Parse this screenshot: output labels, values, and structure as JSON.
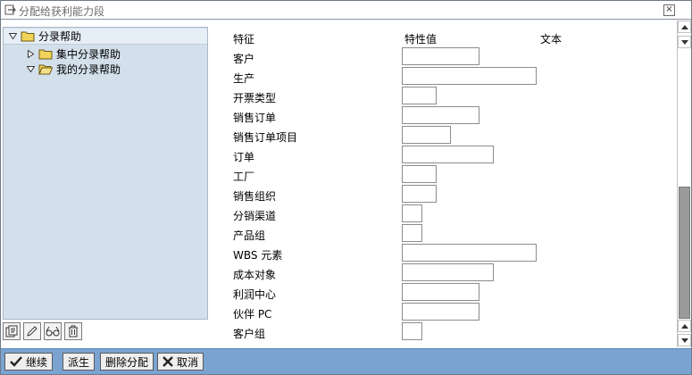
{
  "window": {
    "title": "分配给获利能力段",
    "close_symbol": "×"
  },
  "tree": {
    "items": [
      {
        "label": "分录帮助",
        "expanded": true
      },
      {
        "label": "集中分录帮助",
        "expanded": false
      },
      {
        "label": "我的分录帮助",
        "expanded": true
      }
    ]
  },
  "form": {
    "headers": {
      "feature": "特征",
      "value": "特性值",
      "text": "文本"
    },
    "rows": [
      {
        "label": "客户",
        "value": ""
      },
      {
        "label": "生产",
        "value": ""
      },
      {
        "label": "开票类型",
        "value": ""
      },
      {
        "label": "销售订单",
        "value": ""
      },
      {
        "label": "销售订单项目",
        "value": ""
      },
      {
        "label": "订单",
        "value": ""
      },
      {
        "label": "工厂",
        "value": ""
      },
      {
        "label": "销售组织",
        "value": ""
      },
      {
        "label": "分销渠道",
        "value": ""
      },
      {
        "label": "产品组",
        "value": ""
      },
      {
        "label": "WBS 元素",
        "value": ""
      },
      {
        "label": "成本对象",
        "value": ""
      },
      {
        "label": "利润中心",
        "value": ""
      },
      {
        "label": "伙伴 PC",
        "value": ""
      },
      {
        "label": "客户组",
        "value": ""
      }
    ]
  },
  "bottombar": {
    "continue_label": "继续",
    "derive_label": "派生",
    "delete_label": "删除分配",
    "cancel_label": "取消"
  },
  "icons": {
    "title": "document-arrow-icon",
    "folder": "folder-icon",
    "tool1": "display-details-icon",
    "tool2": "edit-pencil-icon",
    "tool3": "glasses-icon",
    "tool4": "trash-icon",
    "continue": "checkmark-icon",
    "cancel": "cross-icon"
  },
  "colors": {
    "tree_bg": "#d3dfeb",
    "bottom_bar": "#7aa3d2",
    "folder": "#f2d35a"
  }
}
